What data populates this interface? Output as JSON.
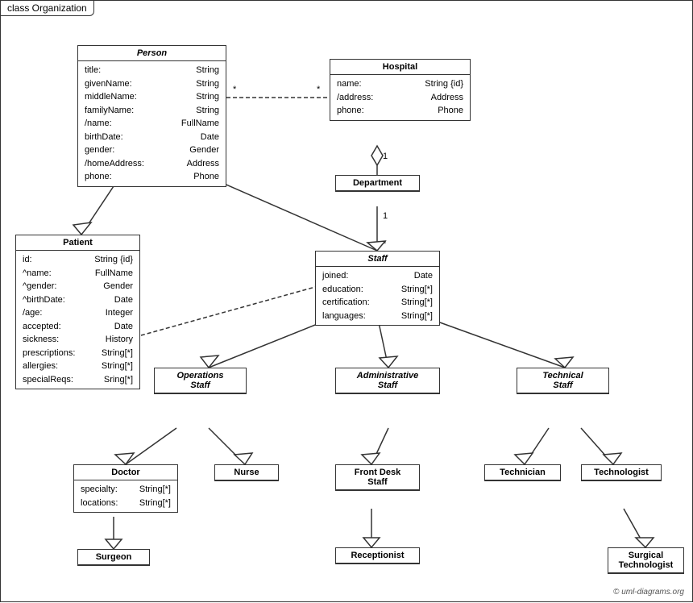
{
  "diagram": {
    "title": "class Organization",
    "copyright": "© uml-diagrams.org",
    "classes": {
      "person": {
        "name": "Person",
        "italic": true,
        "attrs": [
          {
            "name": "title:",
            "type": "String"
          },
          {
            "name": "givenName:",
            "type": "String"
          },
          {
            "name": "middleName:",
            "type": "String"
          },
          {
            "name": "familyName:",
            "type": "String"
          },
          {
            "name": "/name:",
            "type": "FullName"
          },
          {
            "name": "birthDate:",
            "type": "Date"
          },
          {
            "name": "gender:",
            "type": "Gender"
          },
          {
            "name": "/homeAddress:",
            "type": "Address"
          },
          {
            "name": "phone:",
            "type": "Phone"
          }
        ]
      },
      "hospital": {
        "name": "Hospital",
        "italic": false,
        "attrs": [
          {
            "name": "name:",
            "type": "String {id}"
          },
          {
            "name": "/address:",
            "type": "Address"
          },
          {
            "name": "phone:",
            "type": "Phone"
          }
        ]
      },
      "department": {
        "name": "Department",
        "italic": false,
        "attrs": []
      },
      "staff": {
        "name": "Staff",
        "italic": true,
        "attrs": [
          {
            "name": "joined:",
            "type": "Date"
          },
          {
            "name": "education:",
            "type": "String[*]"
          },
          {
            "name": "certification:",
            "type": "String[*]"
          },
          {
            "name": "languages:",
            "type": "String[*]"
          }
        ]
      },
      "patient": {
        "name": "Patient",
        "italic": false,
        "attrs": [
          {
            "name": "id:",
            "type": "String {id}"
          },
          {
            "name": "^name:",
            "type": "FullName"
          },
          {
            "name": "^gender:",
            "type": "Gender"
          },
          {
            "name": "^birthDate:",
            "type": "Date"
          },
          {
            "name": "/age:",
            "type": "Integer"
          },
          {
            "name": "accepted:",
            "type": "Date"
          },
          {
            "name": "sickness:",
            "type": "History"
          },
          {
            "name": "prescriptions:",
            "type": "String[*]"
          },
          {
            "name": "allergies:",
            "type": "String[*]"
          },
          {
            "name": "specialReqs:",
            "type": "Sring[*]"
          }
        ]
      },
      "operations_staff": {
        "name": "Operations\nStaff",
        "italic": true,
        "attrs": []
      },
      "administrative_staff": {
        "name": "Administrative\nStaff",
        "italic": true,
        "attrs": []
      },
      "technical_staff": {
        "name": "Technical\nStaff",
        "italic": true,
        "attrs": []
      },
      "doctor": {
        "name": "Doctor",
        "italic": false,
        "attrs": [
          {
            "name": "specialty:",
            "type": "String[*]"
          },
          {
            "name": "locations:",
            "type": "String[*]"
          }
        ]
      },
      "nurse": {
        "name": "Nurse",
        "italic": false,
        "attrs": []
      },
      "front_desk_staff": {
        "name": "Front Desk\nStaff",
        "italic": false,
        "attrs": []
      },
      "technician": {
        "name": "Technician",
        "italic": false,
        "attrs": []
      },
      "technologist": {
        "name": "Technologist",
        "italic": false,
        "attrs": []
      },
      "surgeon": {
        "name": "Surgeon",
        "italic": false,
        "attrs": []
      },
      "receptionist": {
        "name": "Receptionist",
        "italic": false,
        "attrs": []
      },
      "surgical_technologist": {
        "name": "Surgical\nTechnologist",
        "italic": false,
        "attrs": []
      }
    }
  }
}
